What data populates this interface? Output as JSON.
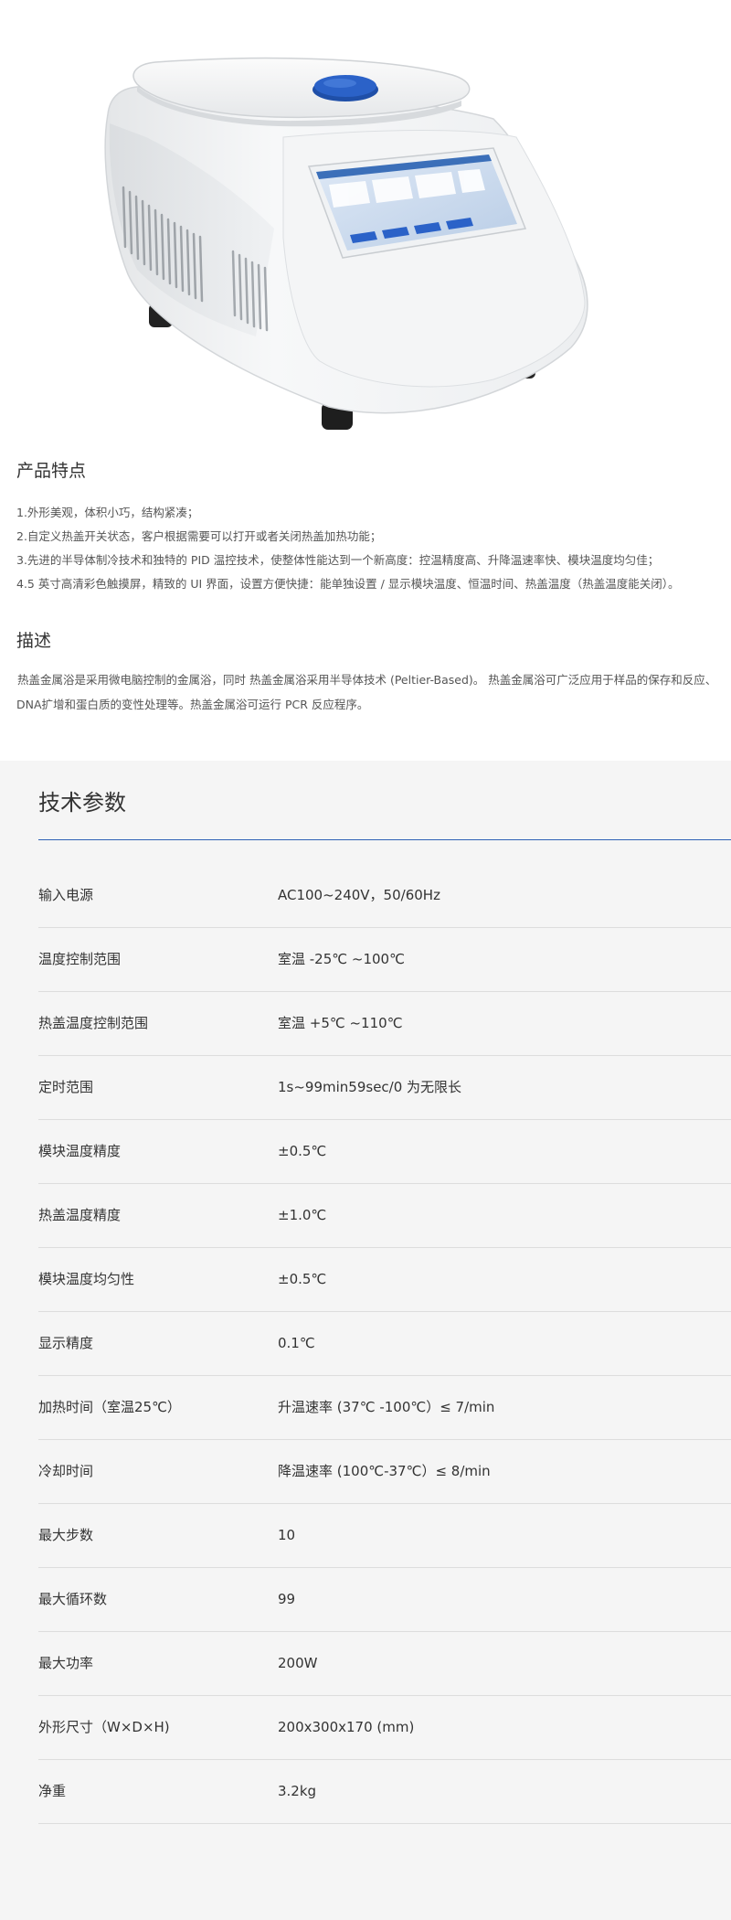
{
  "features": {
    "title": "产品特点",
    "items": [
      "1.外形美观，体积小巧，结构紧凑；",
      "2.自定义热盖开关状态，客户根据需要可以打开或者关闭热盖加热功能；",
      "3.先进的半导体制冷技术和独特的 PID 温控技术，使整体性能达到一个新高度：控温精度高、升降温速率快、模块温度均匀佳；",
      "4.5 英寸高清彩色触摸屏，精致的 UI 界面，设置方便快捷：能单独设置 / 显示模块温度、恒温时间、热盖温度（热盖温度能关闭）。"
    ]
  },
  "description": {
    "title": "描述",
    "text": "热盖金属浴是采用微电脑控制的金属浴，同时 热盖金属浴采用半导体技术 (Peltier-Based)。 热盖金属浴可广泛应用于样品的保存和反应、DNA扩增和蛋白质的变性处理等。热盖金属浴可运行 PCR 反应程序。"
  },
  "specs": {
    "title": "技术参数",
    "rows": [
      {
        "label": "输入电源",
        "value": "AC100~240V，50/60Hz"
      },
      {
        "label": "温度控制范围",
        "value": "室温 -25℃ ~100℃"
      },
      {
        "label": "热盖温度控制范围",
        "value": "室温 +5℃ ~110℃"
      },
      {
        "label": "定时范围",
        "value": "1s~99min59sec/0 为无限长"
      },
      {
        "label": "模块温度精度",
        "value": "±0.5℃"
      },
      {
        "label": "热盖温度精度",
        "value": "±1.0℃"
      },
      {
        "label": "模块温度均匀性",
        "value": "±0.5℃"
      },
      {
        "label": "显示精度",
        "value": "0.1℃"
      },
      {
        "label": "加热时间（室温25℃）",
        "value": "升温速率 (37℃ -100℃）≤ 7/min"
      },
      {
        "label": "冷却时间",
        "value": "降温速率 (100℃-37℃）≤ 8/min"
      },
      {
        "label": "最大步数",
        "value": "10"
      },
      {
        "label": "最大循环数",
        "value": "99"
      },
      {
        "label": "最大功率",
        "value": "200W"
      },
      {
        "label": "外形尺寸（W×D×H)",
        "value": "200x300x170 (mm)"
      },
      {
        "label": "净重",
        "value": "3.2kg"
      }
    ]
  },
  "colors": {
    "accent": "#2f62b5",
    "spec_background": "#f5f5f5",
    "device_button": "#2b62c8"
  }
}
